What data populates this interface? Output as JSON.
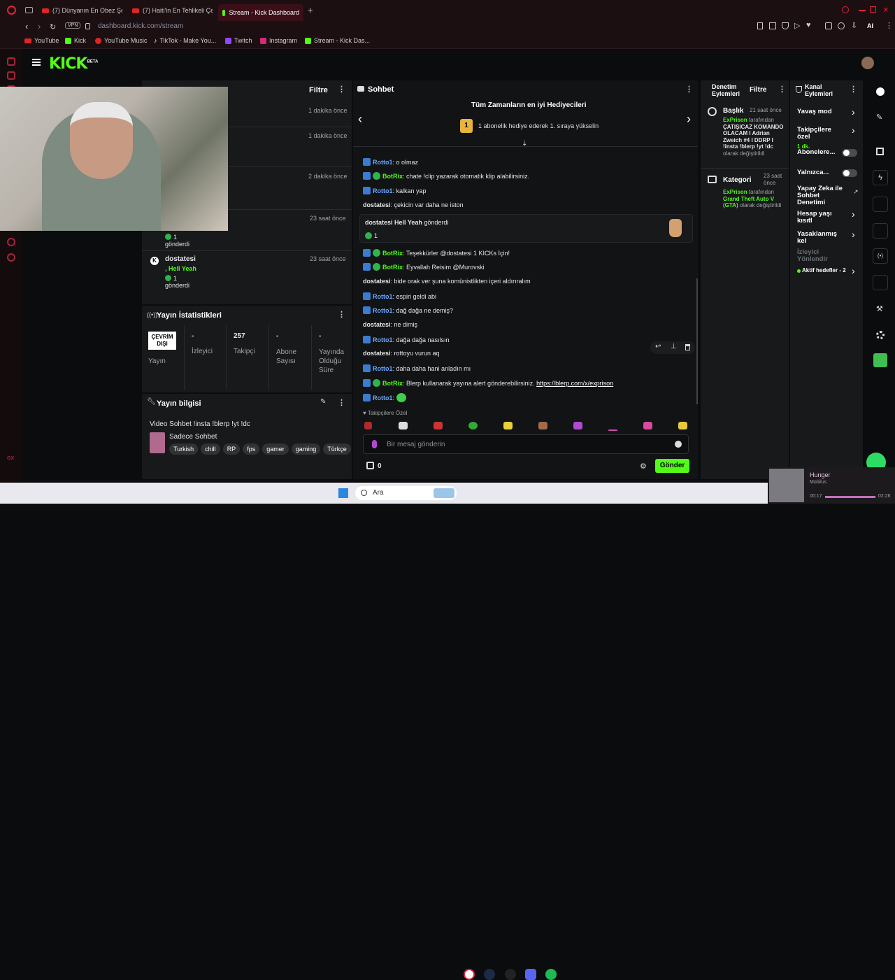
{
  "browser": {
    "tabs": [
      {
        "label": "(7) Dünyanın En Obez Şeh"
      },
      {
        "label": "(7) Haiti'in En Tehlikeli Çet"
      },
      {
        "label": "Stream - Kick Dashboard"
      }
    ],
    "vpn_label": "VPN",
    "url": "dashboard.kick.com/stream",
    "ai_label": "AI",
    "bookmarks": [
      {
        "label": "YouTube"
      },
      {
        "label": "Kick"
      },
      {
        "label": "YouTube Music"
      },
      {
        "label": "TikTok - Make You..."
      },
      {
        "label": "Twitch"
      },
      {
        "label": "Instagram"
      },
      {
        "label": "Stream - Kick Das..."
      }
    ]
  },
  "kick": {
    "logo": "KICK",
    "logo_sup": "BETA"
  },
  "activity": {
    "filter_label": "Filtre",
    "times": [
      "1 dakika önce",
      "1 dakika önce",
      "2 dakika önce",
      "23 saat önce",
      "23 saat önce"
    ],
    "item_count": "1",
    "item_gonderdi": "gönderdi",
    "user_item": {
      "user": "dostatesi",
      "gift": ", Hell Yeah",
      "count": "1",
      "label": "gönderdi"
    }
  },
  "stats": {
    "title": "Yayın İstatistikleri",
    "status_label": "ÇEVRİM DIŞI",
    "status_caption": "Yayın",
    "cols": [
      {
        "value": "-",
        "label": "İzleyici"
      },
      {
        "value": "257",
        "label": "Takipçi"
      },
      {
        "value": "-",
        "label": "Abone Sayısı"
      },
      {
        "value": "-",
        "label": "Yayında Olduğu Süre"
      }
    ]
  },
  "info": {
    "title": "Yayın bilgisi",
    "stream_title": "Video Sohbet !insta !blerp !yt !dc",
    "category": "Sadece Sohbet",
    "tags": [
      "Turkish",
      "chill",
      "RP",
      "fps",
      "gamer",
      "gaming",
      "Türkçe"
    ]
  },
  "chat": {
    "title": "Sohbet",
    "gifters_title": "Tüm Zamanların en iyi Hediyecileri",
    "gifters_rank": "1",
    "gifters_sub": "1 abonelik hediye ederek 1. sıraya yükselin",
    "gift_card": {
      "user": "dostatesi",
      "item": "Hell Yeah",
      "verb": "gönderdi",
      "count": "1"
    },
    "messages": [
      {
        "user": "Rotto1",
        "text": ": o olmaz",
        "type": "blue"
      },
      {
        "user": "BotRix",
        "text": ": chate !clip yazarak otomatik klip alabilirsiniz.",
        "type": "bot"
      },
      {
        "user": "Rotto1",
        "text": ": kalkan yap",
        "type": "blue"
      },
      {
        "user": "dostatesi",
        "text": ": çekicin var daha ne iston",
        "type": "plain"
      },
      {
        "user": "BotRix",
        "text": ": Teşekkürler @dostatesi 1 KICKs İçin!",
        "type": "bot"
      },
      {
        "user": "BotRix",
        "text": ": Eyvallah Reisim @Murovski",
        "type": "bot"
      },
      {
        "user": "dostatesi",
        "text": ": bide orak ver şuna komünistlikten içeri aldırıralım",
        "type": "plain"
      },
      {
        "user": "Rotto1",
        "text": ": espiri geldi abi",
        "type": "blue"
      },
      {
        "user": "Rotto1",
        "text": ": dağ dağa ne demiş?",
        "type": "blue"
      },
      {
        "user": "dostatesi",
        "text": ": ne dimiş",
        "type": "plain"
      },
      {
        "user": "Rotto1",
        "text": ": dağa dağa nasılsın",
        "type": "blue"
      },
      {
        "user": "dostatesi",
        "text": ": rottoyu vurun aq",
        "type": "plain"
      },
      {
        "user": "Rotto1",
        "text": ": daha daha hani anladın mı",
        "type": "blue"
      },
      {
        "user": "BotRix",
        "text": ": Blerp kullanarak yayına alert gönderebilirsiniz. ",
        "type": "bot",
        "link": "https://blerp.com/x/exprison"
      },
      {
        "user": "Rotto1",
        "text": ":",
        "type": "blue"
      }
    ],
    "followers_only": "Takipçilere Özel",
    "input_placeholder": "Bir mesaj gönderin",
    "points": "0",
    "send_label": "Gönder"
  },
  "moderation": {
    "title": "Denetim Eylemleri",
    "filter_label": "Filtre",
    "items": [
      {
        "heading": "Başlık",
        "time": "21 saat önce",
        "actor": "ExPrison",
        "by": " tarafından",
        "value": "ÇATIŞICAZ KOMANDO OLACAM I Adrian Zweich #4 I DDRP I !insta !blerp !yt !dc",
        "suffix": " olarak değiştirildi"
      },
      {
        "heading": "Kategori",
        "time": "23 saat önce",
        "actor": "ExPrison",
        "by": " tarafından",
        "value": "Grand Theft Auto V (GTA)",
        "suffix": " olarak değiştirildi"
      }
    ]
  },
  "channel": {
    "title": "Kanal Eylemleri",
    "items": [
      {
        "label": "Yavaş mod",
        "control": "arrow"
      },
      {
        "label": "Takipçilere özel",
        "sub": "1 dk.",
        "control": "arrow"
      },
      {
        "label": "Abonelere...",
        "control": "toggle"
      },
      {
        "label": "Yalnızca...",
        "control": "toggle"
      },
      {
        "label": "Yapay Zeka ile Sohbet Denetimi",
        "control": "ext"
      },
      {
        "label": "Hesap yaşı kısıtl",
        "control": "arrow"
      },
      {
        "label": "Yasaklanmış kel",
        "control": "arrow"
      },
      {
        "label": "İzleyici Yönlendir",
        "control": "none"
      },
      {
        "label": "Aktif hedefler - 2",
        "control": "arrow"
      }
    ]
  },
  "taskbar": {
    "search_label": "Ara",
    "media_title": "Hunger",
    "media_artist": "Mobilus",
    "media_elapsed": "00:17",
    "media_total": "02:26"
  },
  "colors": {
    "accent": "#53fc18",
    "brand_red": "#e02424",
    "chat_blue": "#6ea8ff"
  }
}
